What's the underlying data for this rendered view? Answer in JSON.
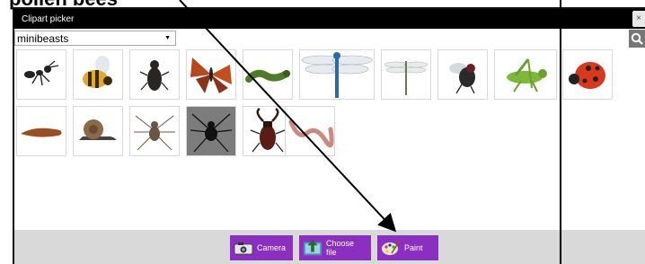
{
  "top_text": "pollen bees",
  "dialog": {
    "title": "Clipart picker",
    "close_label": "×",
    "category_select": {
      "selected": "minibeasts"
    },
    "search_button_icon": "search-icon"
  },
  "clipart_items": [
    {
      "name": "ant"
    },
    {
      "name": "bee"
    },
    {
      "name": "beetle"
    },
    {
      "name": "butterfly"
    },
    {
      "name": "caterpillar"
    },
    {
      "name": "dragonfly"
    },
    {
      "name": "damselfly"
    },
    {
      "name": "fly"
    },
    {
      "name": "grasshopper"
    },
    {
      "name": "ladybird"
    },
    {
      "name": "slug"
    },
    {
      "name": "snail"
    },
    {
      "name": "spider"
    },
    {
      "name": "black-spider"
    },
    {
      "name": "stag-beetle"
    },
    {
      "name": "worm"
    }
  ],
  "footer": {
    "camera_label": "Camera",
    "choose_file_label": "Choose file",
    "paint_label": "Paint"
  },
  "colors": {
    "titlebar": "#000000",
    "button": "#8a2fbf",
    "footer": "#d9d9d9"
  }
}
